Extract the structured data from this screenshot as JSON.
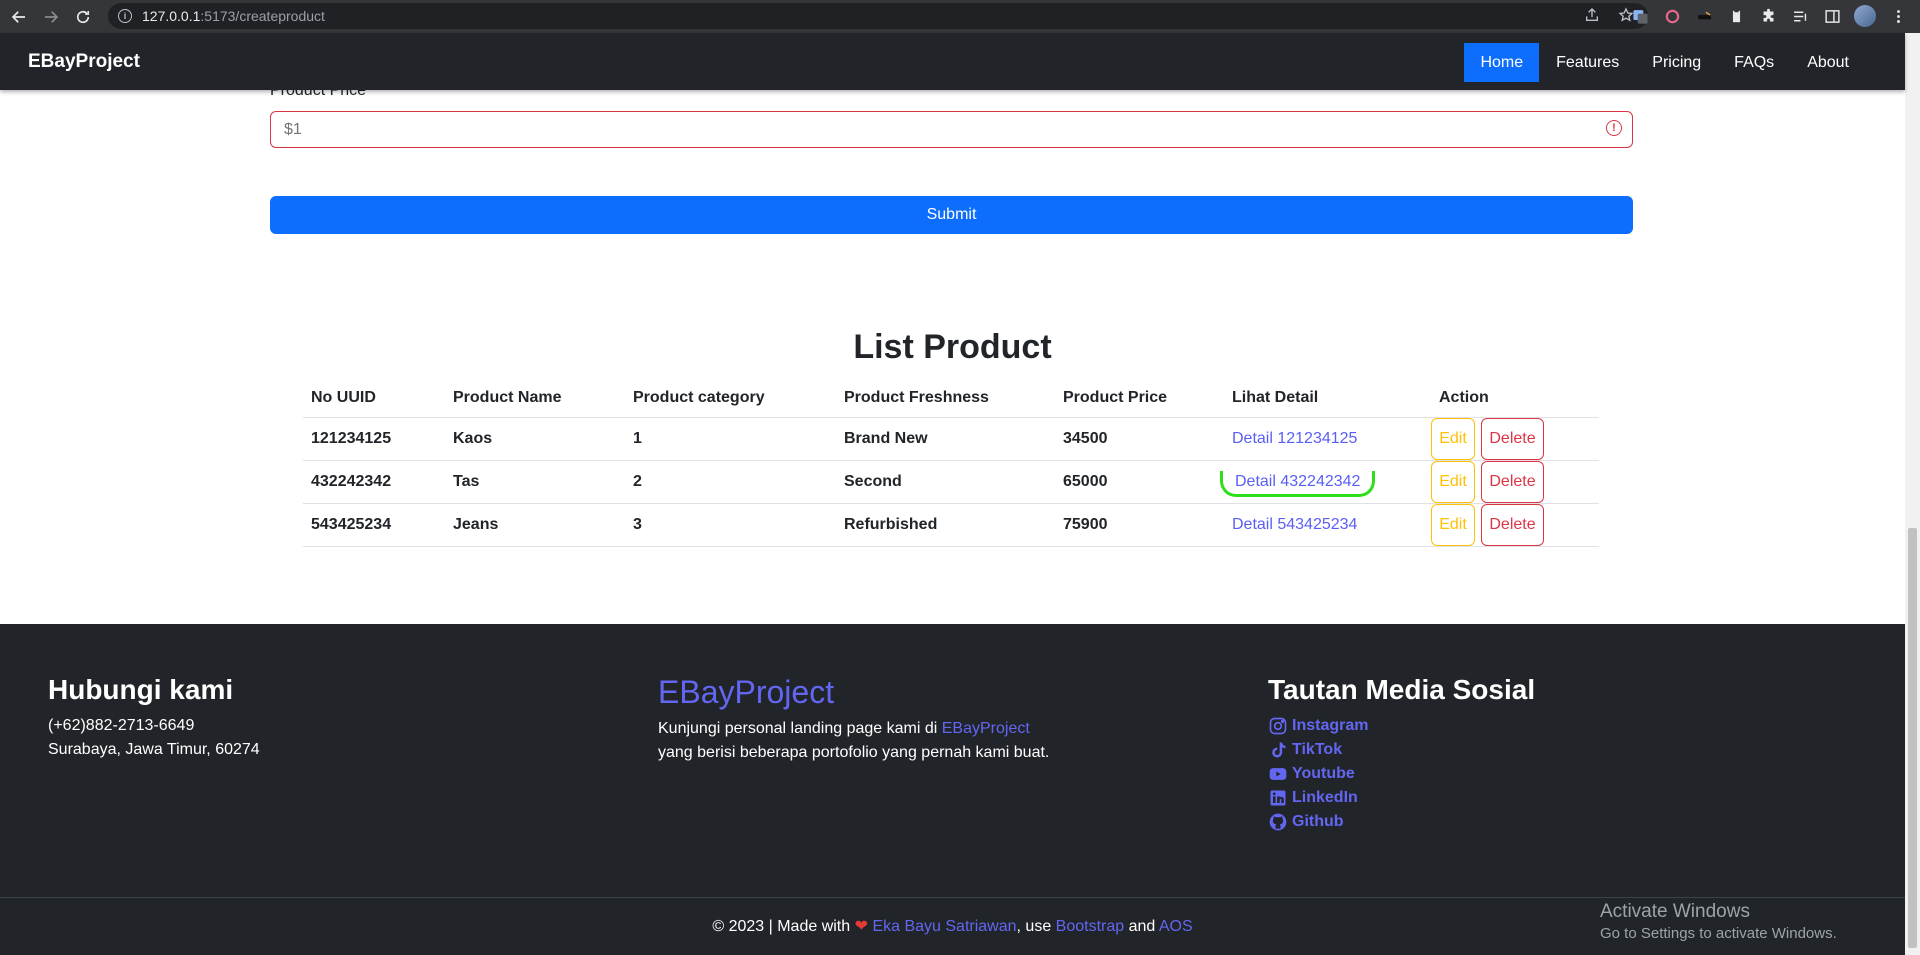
{
  "browser": {
    "url_host": "127.0.0.1",
    "url_path": ":5173/createproduct"
  },
  "navbar": {
    "brand": "EBayProject",
    "links": [
      "Home",
      "Features",
      "Pricing",
      "FAQs",
      "About"
    ],
    "active": "Home"
  },
  "form": {
    "price_label": "Product Price",
    "price_placeholder": "$1",
    "submit_label": "Submit"
  },
  "list": {
    "title": "List Product",
    "headers": [
      "No UUID",
      "Product Name",
      "Product category",
      "Product Freshness",
      "Product Price",
      "Lihat Detail",
      "Action"
    ],
    "rows": [
      {
        "uuid": "121234125",
        "name": "Kaos",
        "category": "1",
        "freshness": "Brand New",
        "price": "34500",
        "detail": "Detail 121234125"
      },
      {
        "uuid": "432242342",
        "name": "Tas",
        "category": "2",
        "freshness": "Second",
        "price": "65000",
        "detail": "Detail 432242342"
      },
      {
        "uuid": "543425234",
        "name": "Jeans",
        "category": "3",
        "freshness": "Refurbished",
        "price": "75900",
        "detail": "Detail 543425234"
      }
    ],
    "edit_label": "Edit",
    "delete_label": "Delete"
  },
  "footer": {
    "contact_title": "Hubungi kami",
    "phone": "(+62)882-2713-6649",
    "address": "Surabaya, Jawa Timur, 60274",
    "brand": "EBayProject",
    "about_line1_pre": "Kunjungi personal landing page kami di ",
    "about_line1_link": "EBayProject",
    "about_line2": "yang berisi beberapa portofolio yang pernah kami buat.",
    "social_title": "Tautan Media Sosial",
    "social": [
      "Instagram",
      "TikTok",
      "Youtube",
      "LinkedIn",
      "Github"
    ],
    "copyright_pre": "© 2023 | Made with",
    "author": "Eka Bayu Satriawan",
    "use": ", use ",
    "bootstrap": "Bootstrap",
    "and": " and ",
    "aos": "AOS"
  },
  "windows": {
    "line1": "Activate Windows",
    "line2": "Go to Settings to activate Windows."
  },
  "colors": {
    "navbar_bg": "#212529",
    "primary": "#0d6efd",
    "accent": "#6366f1",
    "danger": "#dc3545",
    "warning": "#ffc107",
    "highlight": "#2dde1a"
  }
}
